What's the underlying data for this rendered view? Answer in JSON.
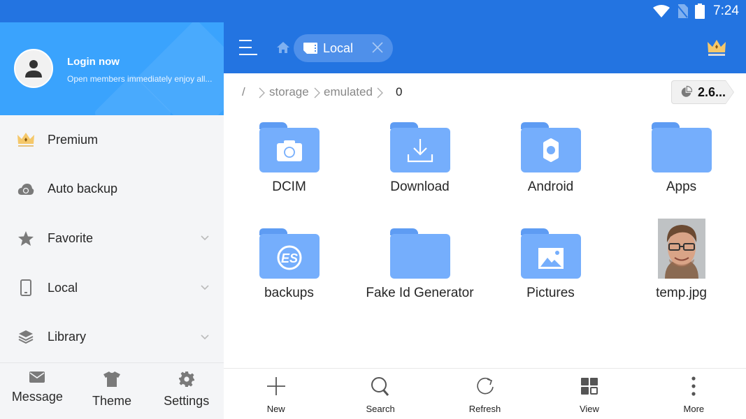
{
  "status_bar": {
    "time": "7:24",
    "icons": [
      "wifi-icon",
      "no-sim-icon",
      "battery-icon"
    ]
  },
  "drawer": {
    "header": {
      "title": "Login now",
      "subtitle": "Open members immediately enjoy all..."
    },
    "items": [
      {
        "label": "Premium",
        "icon": "crown-icon",
        "expandable": false
      },
      {
        "label": "Auto backup",
        "icon": "cloud-sync-icon",
        "expandable": false
      },
      {
        "label": "Favorite",
        "icon": "star-icon",
        "expandable": true
      },
      {
        "label": "Local",
        "icon": "phone-icon",
        "expandable": true
      },
      {
        "label": "Library",
        "icon": "layers-icon",
        "expandable": true
      }
    ],
    "bottom": [
      {
        "label": "Message",
        "icon": "mail-icon"
      },
      {
        "label": "Theme",
        "icon": "shirt-icon"
      },
      {
        "label": "Settings",
        "icon": "gear-icon"
      }
    ]
  },
  "toolbar": {
    "tab_label": "Local"
  },
  "path": {
    "root": "/",
    "segments": [
      "storage",
      "emulated",
      "0"
    ],
    "storage_value": "2.6..."
  },
  "files": [
    {
      "name": "DCIM",
      "type": "folder",
      "badge": "camera-icon"
    },
    {
      "name": "Download",
      "type": "folder",
      "badge": "download-icon"
    },
    {
      "name": "Android",
      "type": "folder",
      "badge": "gear-icon"
    },
    {
      "name": "Apps",
      "type": "folder",
      "badge": ""
    },
    {
      "name": "backups",
      "type": "folder",
      "badge": "es-logo-icon"
    },
    {
      "name": "Fake Id Generator",
      "type": "folder",
      "badge": ""
    },
    {
      "name": "Pictures",
      "type": "folder",
      "badge": "image-icon"
    },
    {
      "name": "temp.jpg",
      "type": "image",
      "badge": "portrait-thumbnail"
    }
  ],
  "bottom_bar": [
    {
      "label": "New",
      "icon": "plus-icon"
    },
    {
      "label": "Search",
      "icon": "search-icon"
    },
    {
      "label": "Refresh",
      "icon": "refresh-icon"
    },
    {
      "label": "View",
      "icon": "grid-view-icon"
    },
    {
      "label": "More",
      "icon": "more-vert-icon"
    }
  ],
  "colors": {
    "primary": "#2374e1",
    "drawer_header": "#3aa3fd",
    "folder": "#75aefc",
    "folder_tab": "#5e9cf3"
  }
}
